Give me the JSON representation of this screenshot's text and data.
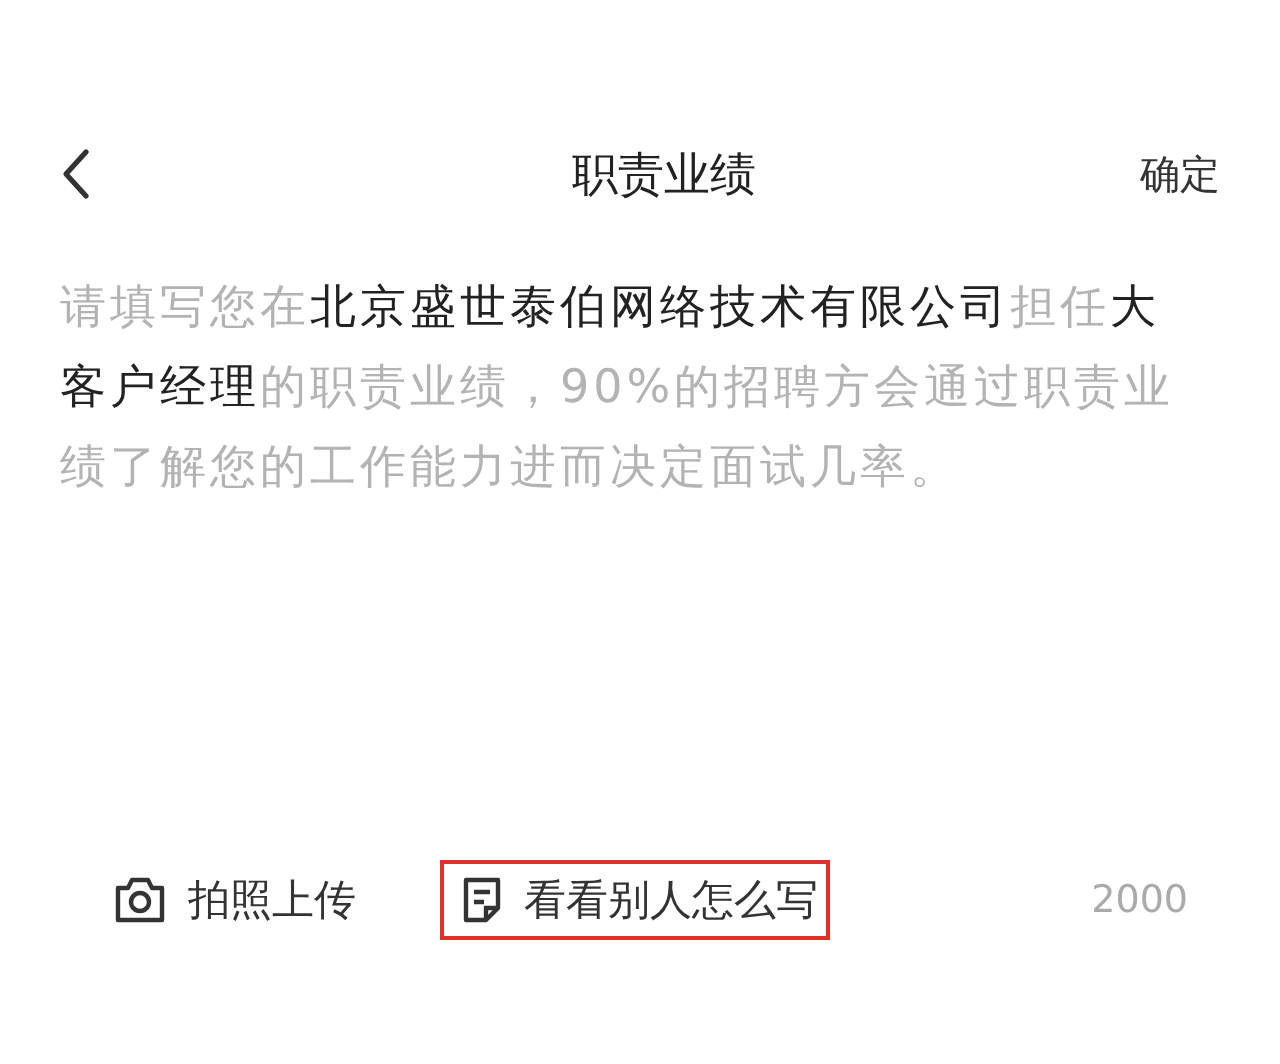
{
  "header": {
    "title": "职责业绩",
    "confirm": "确定"
  },
  "hint": [
    {
      "text": "请填写您在",
      "highlight": false
    },
    {
      "text": "北京盛世泰伯网络技术有限公司",
      "highlight": true
    },
    {
      "text": "担任",
      "highlight": false
    },
    {
      "text": "大客户经理",
      "highlight": true
    },
    {
      "text": "的职责业绩，90%的招聘方会通过职责业绩了解您的工作能力进而决定面试几率。",
      "highlight": false
    }
  ],
  "toolbar": [
    {
      "kind": "camera",
      "label": "拍照上传",
      "outlined": false
    },
    {
      "kind": "note",
      "label": "看看别人怎么写",
      "outlined": true
    }
  ],
  "counter": "2000"
}
